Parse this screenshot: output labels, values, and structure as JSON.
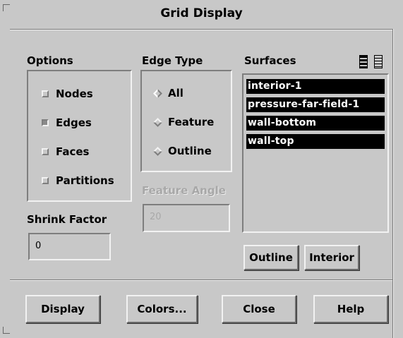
{
  "window": {
    "title": "Grid Display"
  },
  "options": {
    "label": "Options",
    "items": [
      {
        "label": "Nodes",
        "checked": false
      },
      {
        "label": "Edges",
        "checked": true
      },
      {
        "label": "Faces",
        "checked": false
      },
      {
        "label": "Partitions",
        "checked": false
      }
    ]
  },
  "edge_type": {
    "label": "Edge Type",
    "items": [
      {
        "label": "All",
        "selected": true
      },
      {
        "label": "Feature",
        "selected": false
      },
      {
        "label": "Outline",
        "selected": false
      }
    ]
  },
  "feature_angle": {
    "label": "Feature Angle",
    "value": "20"
  },
  "shrink_factor": {
    "label": "Shrink Factor",
    "value": "0"
  },
  "surfaces": {
    "label": "Surfaces",
    "items": [
      "interior-1",
      "pressure-far-field-1",
      "wall-bottom",
      "wall-top"
    ],
    "outline_button": "Outline",
    "interior_button": "Interior"
  },
  "buttons": {
    "display": "Display",
    "colors": "Colors...",
    "close": "Close",
    "help": "Help"
  }
}
